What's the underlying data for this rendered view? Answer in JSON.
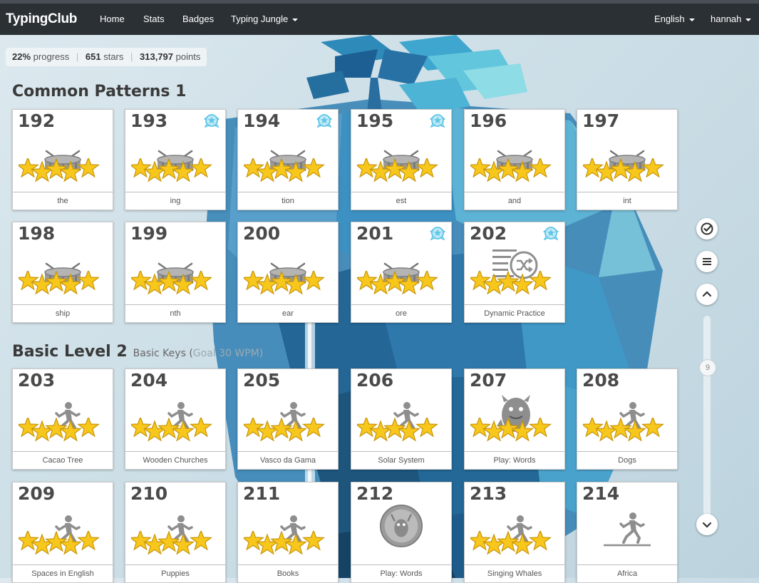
{
  "nav": {
    "brand": "TypingClub",
    "links": [
      "Home",
      "Stats",
      "Badges",
      "Typing Jungle"
    ],
    "language": "English",
    "user": "hannah"
  },
  "progress": {
    "percent": "22%",
    "percent_label": "progress",
    "stars": "651",
    "stars_label": "stars",
    "points": "313,797",
    "points_label": "points"
  },
  "sections": [
    {
      "title": "Common Patterns 1",
      "subtitle": "",
      "subtitle_faded": ""
    },
    {
      "title": "Basic Level 2",
      "subtitle": "Basic Keys (",
      "subtitle_faded": "Goal 30 WPM)"
    }
  ],
  "lessons": [
    {
      "num": "192",
      "label": "the",
      "icon": "drum-icon",
      "stars": 5,
      "badge": false
    },
    {
      "num": "193",
      "label": "ing",
      "icon": "drum-icon",
      "stars": 5,
      "badge": true
    },
    {
      "num": "194",
      "label": "tion",
      "icon": "drum-icon",
      "stars": 5,
      "badge": true
    },
    {
      "num": "195",
      "label": "est",
      "icon": "drum-icon",
      "stars": 5,
      "badge": true
    },
    {
      "num": "196",
      "label": "and",
      "icon": "drum-icon",
      "stars": 5,
      "badge": false
    },
    {
      "num": "197",
      "label": "int",
      "icon": "drum-icon",
      "stars": 5,
      "badge": false
    },
    {
      "num": "198",
      "label": "ship",
      "icon": "drum-icon",
      "stars": 5,
      "badge": false
    },
    {
      "num": "199",
      "label": "nth",
      "icon": "drum-icon",
      "stars": 5,
      "badge": false
    },
    {
      "num": "200",
      "label": "ear",
      "icon": "drum-icon",
      "stars": 5,
      "badge": false
    },
    {
      "num": "201",
      "label": "ore",
      "icon": "drum-icon",
      "stars": 5,
      "badge": true
    },
    {
      "num": "202",
      "label": "Dynamic Practice",
      "icon": "shuffle-practice-icon",
      "stars": 5,
      "badge": true
    },
    {
      "num": "203",
      "label": "Cacao Tree",
      "icon": "runner-icon",
      "stars": 5,
      "badge": false
    },
    {
      "num": "204",
      "label": "Wooden Churches",
      "icon": "runner-icon",
      "stars": 5,
      "badge": false
    },
    {
      "num": "205",
      "label": "Vasco da Gama",
      "icon": "runner-icon",
      "stars": 5,
      "badge": false
    },
    {
      "num": "206",
      "label": "Solar System",
      "icon": "runner-icon",
      "stars": 5,
      "badge": false
    },
    {
      "num": "207",
      "label": "Play: Words",
      "icon": "monster-icon",
      "stars": 5,
      "badge": false
    },
    {
      "num": "208",
      "label": "Dogs",
      "icon": "runner-icon",
      "stars": 5,
      "badge": false
    },
    {
      "num": "209",
      "label": "Spaces in English",
      "icon": "runner-icon",
      "stars": 5,
      "badge": false
    },
    {
      "num": "210",
      "label": "Puppies",
      "icon": "runner-icon",
      "stars": 5,
      "badge": false
    },
    {
      "num": "211",
      "label": "Books",
      "icon": "runner-icon",
      "stars": 5,
      "badge": false
    },
    {
      "num": "212",
      "label": "Play: Words",
      "icon": "bubble-creature-icon",
      "stars": 0,
      "badge": false
    },
    {
      "num": "213",
      "label": "Singing Whales",
      "icon": "runner-icon",
      "stars": 5,
      "badge": false
    },
    {
      "num": "214",
      "label": "Africa",
      "icon": "runner-line-icon",
      "stars": 0,
      "badge": false
    }
  ],
  "rail": {
    "page_number": "9",
    "buttons": [
      "check-circle-icon",
      "menu-icon",
      "chevron-up-icon",
      "chevron-down-icon"
    ]
  },
  "colors": {
    "nav_bg": "#2b3035",
    "star": "#f7c71c",
    "badge": "#5ec6e8",
    "icon_gray": "#8e8e8e"
  }
}
